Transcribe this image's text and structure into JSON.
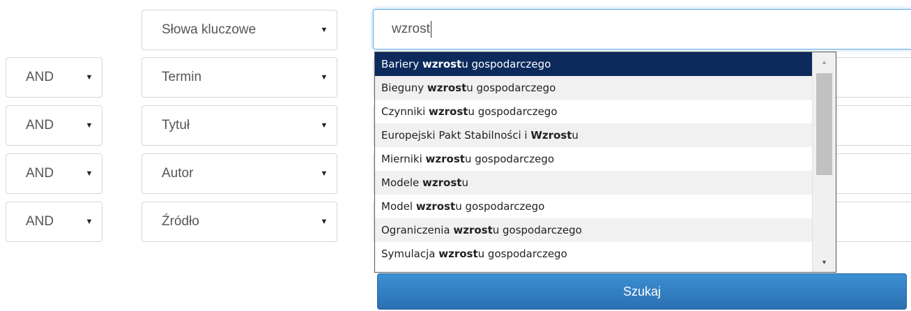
{
  "search": {
    "field_select": "Słowa kluczowe",
    "query_value": "wzrost"
  },
  "rows": [
    {
      "operator": "AND",
      "field": "Termin"
    },
    {
      "operator": "AND",
      "field": "Tytuł"
    },
    {
      "operator": "AND",
      "field": "Autor"
    },
    {
      "operator": "AND",
      "field": "Źródło"
    }
  ],
  "arrow_glyph": "▼",
  "suggestions": [
    {
      "before": "Bariery ",
      "match": "wzrost",
      "after": "u gospodarczego"
    },
    {
      "before": "Bieguny ",
      "match": "wzrost",
      "after": "u gospodarczego"
    },
    {
      "before": "Czynniki ",
      "match": "wzrost",
      "after": "u gospodarczego"
    },
    {
      "before": "Europejski Pakt Stabilności i ",
      "match": "Wzrost",
      "after": "u"
    },
    {
      "before": "Mierniki ",
      "match": "wzrost",
      "after": "u gospodarczego"
    },
    {
      "before": "Modele ",
      "match": "wzrost",
      "after": "u"
    },
    {
      "before": "Model ",
      "match": "wzrost",
      "after": "u gospodarczego"
    },
    {
      "before": "Ograniczenia ",
      "match": "wzrost",
      "after": "u gospodarczego"
    },
    {
      "before": "Symulacja ",
      "match": "wzrost",
      "after": "u gospodarczego"
    }
  ],
  "active_suggestion_index": 0,
  "search_button_label": "Szukaj",
  "colors": {
    "active_item_bg": "#0c2a5c",
    "button_bg": "#3478c0",
    "focus_border": "#66afe9"
  }
}
